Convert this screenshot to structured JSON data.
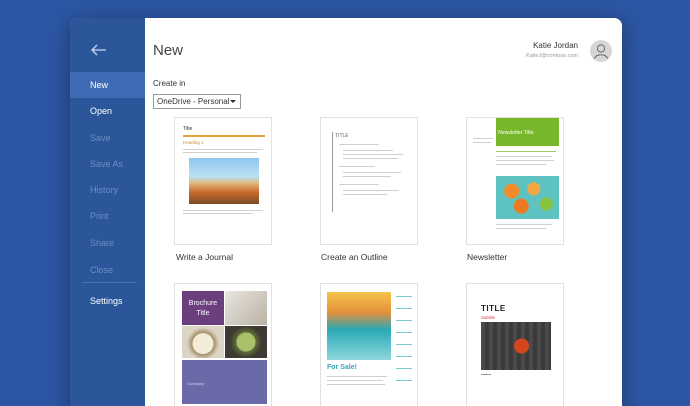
{
  "sidebar": {
    "items": [
      {
        "label": "New",
        "state": "active"
      },
      {
        "label": "Open",
        "state": "enabled"
      },
      {
        "label": "Save",
        "state": "disabled"
      },
      {
        "label": "Save As",
        "state": "disabled"
      },
      {
        "label": "History",
        "state": "disabled"
      },
      {
        "label": "Print",
        "state": "disabled"
      },
      {
        "label": "Share",
        "state": "disabled"
      },
      {
        "label": "Close",
        "state": "disabled"
      },
      {
        "label": "Settings",
        "state": "enabled"
      }
    ],
    "back_icon": "back-arrow-icon"
  },
  "main": {
    "title": "New",
    "create_in_label": "Create in",
    "location_value": "OneDrive - Personal"
  },
  "user": {
    "name": "Katie Jordan",
    "email": "KatieJ@contoso.com"
  },
  "templates": [
    {
      "label": "Write a Journal",
      "thumb_title": "Title",
      "thumb_heading": "Heading 1"
    },
    {
      "label": "Create an Outline",
      "thumb_title": "TITLE"
    },
    {
      "label": "Newsletter",
      "thumb_title": "Newsletter Title"
    },
    {
      "label": "",
      "thumb_title": "Brochure Title",
      "thumb_footer": "Company"
    },
    {
      "label": "",
      "thumb_title": "For Sale!"
    },
    {
      "label": "",
      "thumb_title": "TITLE",
      "thumb_subtitle": "Subtitle"
    }
  ],
  "colors": {
    "sidebar_bg": "#2b579a",
    "desktop_bg": "#2c56a3",
    "newsletter_green": "#76b82a",
    "brochure_purple": "#6b5b95",
    "accent_orange": "#e8a33d"
  }
}
